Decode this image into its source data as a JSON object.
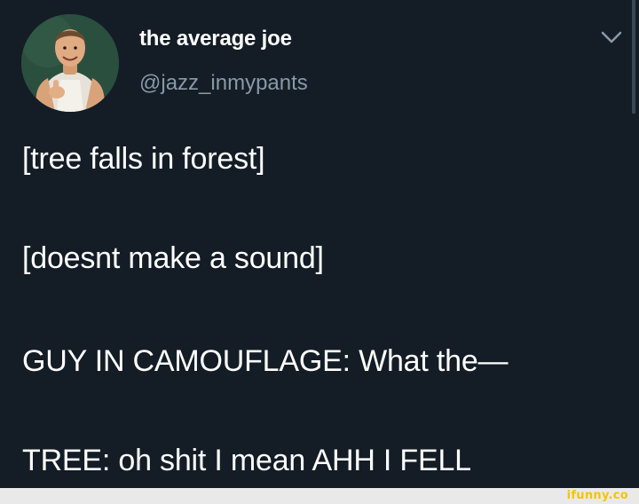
{
  "author": {
    "display_name": "the average joe",
    "handle": "@jazz_inmypants",
    "avatar_icon": "person-avatar"
  },
  "menu": {
    "icon": "chevron-down-icon"
  },
  "tweet": {
    "lines": [
      "[tree falls in forest]",
      "[doesnt make a sound]",
      "GUY IN CAMOUFLAGE: What the—",
      "TREE: oh shit I mean AHH I FELL"
    ]
  },
  "watermark": {
    "text": "ifunny.co"
  },
  "colors": {
    "background": "#141d26",
    "text": "#ffffff",
    "muted": "#8899a6",
    "watermark": "#f5c400"
  }
}
